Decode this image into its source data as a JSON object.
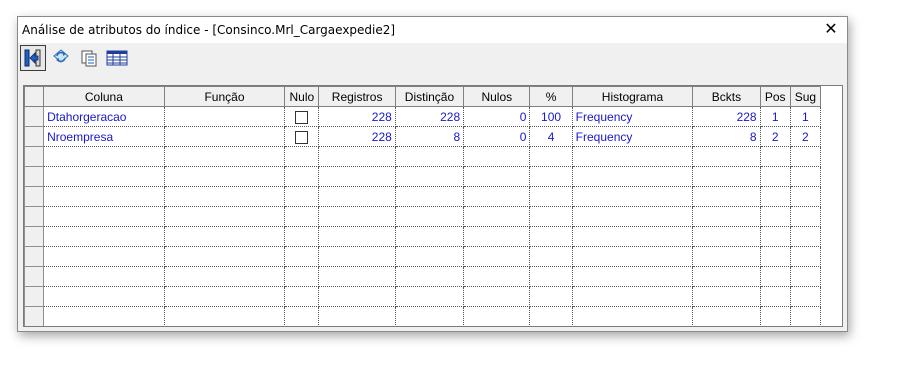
{
  "window": {
    "title": "Análise de atributos do índice - [Consinco.Mrl_Cargaexpedie2]",
    "close_glyph": "✕"
  },
  "toolbar": {
    "buttons": [
      {
        "icon": "exit-door-icon"
      },
      {
        "icon": "refresh-icon"
      },
      {
        "icon": "copy-icon"
      },
      {
        "icon": "grid-icon"
      }
    ]
  },
  "grid": {
    "columns": [
      "Coluna",
      "Função",
      "Nulo",
      "Registros",
      "Distinção",
      "Nulos",
      "%",
      "Histograma",
      "Bckts",
      "Pos",
      "Sug"
    ],
    "rows": [
      {
        "coluna": "Dtahorgeracao",
        "funcao": "",
        "nulo": false,
        "registros": "228",
        "distincao": "228",
        "nulos": "0",
        "pct": "100",
        "histograma": "Frequency",
        "bckts": "228",
        "pos": "1",
        "sug": "1"
      },
      {
        "coluna": "Nroempresa",
        "funcao": "",
        "nulo": false,
        "registros": "228",
        "distincao": "8",
        "nulos": "0",
        "pct": "4",
        "histograma": "Frequency",
        "bckts": "8",
        "pos": "2",
        "sug": "2"
      }
    ],
    "empty_rows": 9
  },
  "colors": {
    "cell_text": "#1818c8",
    "window_bg": "#f0f0f0"
  }
}
